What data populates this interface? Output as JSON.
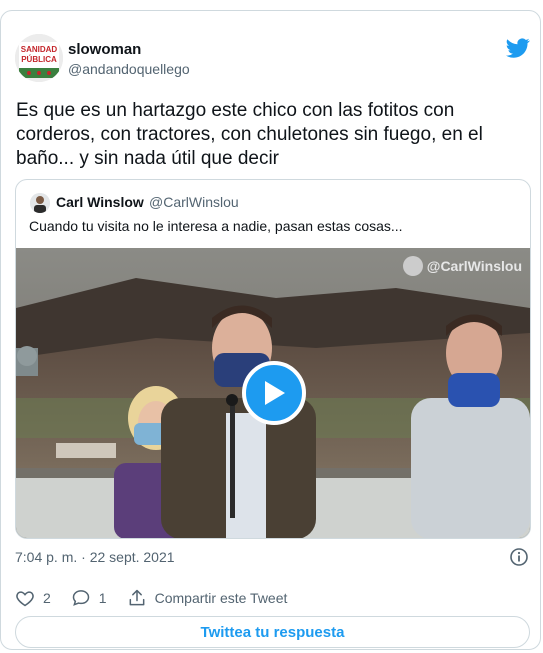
{
  "author": {
    "name": "slowoman",
    "handle": "@andandoquellego",
    "avatar_text_top": "SANIDAD",
    "avatar_text_bottom": "PÚBLICA"
  },
  "tweet": {
    "text": "Es que es un hartazgo este chico con las fotitos con corderos, con tractores, con chuletones sin fuego, en el baño... y sin nada útil que decir"
  },
  "quote": {
    "name": "Carl Winslow",
    "handle": "@CarlWinslou",
    "text": "Cuando tu visita no le interesa a nadie, pasan estas cosas...",
    "watermark": "@CarlWinslou"
  },
  "meta": {
    "timestamp": "7:04 p. m. · 22 sept. 2021"
  },
  "actions": {
    "likes": "2",
    "replies": "1",
    "share_label": "Compartir este Tweet"
  },
  "reply_button": {
    "label": "Twittea tu respuesta"
  },
  "colors": {
    "accent": "#1d9bf0",
    "secondary_text": "#536471",
    "border": "#cfd9de"
  },
  "icons": [
    "twitter-bird-icon",
    "heart-icon",
    "reply-bubble-icon",
    "share-icon",
    "info-icon",
    "play-icon"
  ]
}
